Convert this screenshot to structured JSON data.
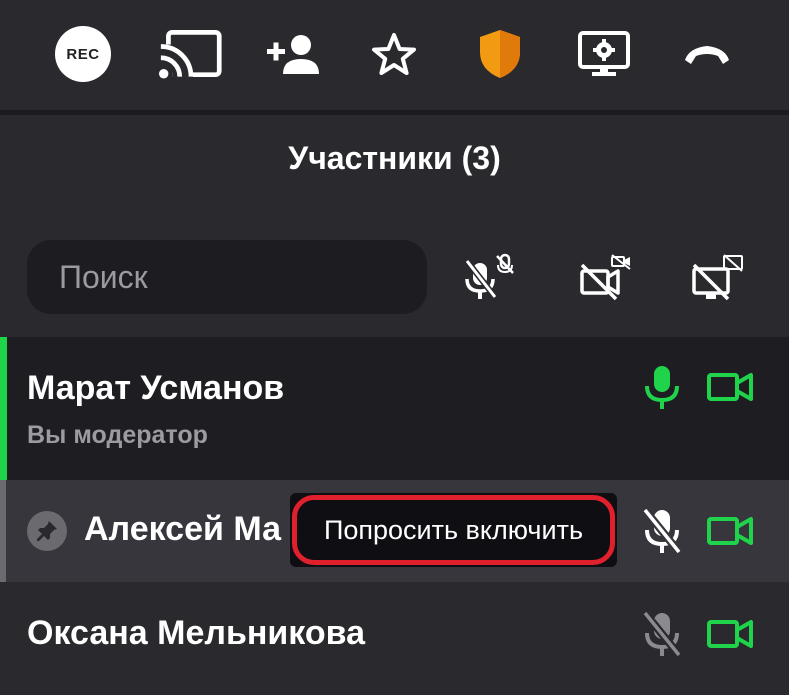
{
  "toolbar": {
    "rec_label": "REC",
    "items": [
      {
        "icon": "rec-icon"
      },
      {
        "icon": "cast-icon"
      },
      {
        "icon": "add-person-icon"
      },
      {
        "icon": "star-icon"
      },
      {
        "icon": "shield-icon"
      },
      {
        "icon": "screen-settings-icon"
      },
      {
        "icon": "hangup-icon"
      }
    ]
  },
  "panel": {
    "title": "Участники (3)"
  },
  "search": {
    "placeholder": "Поиск",
    "value": ""
  },
  "bulk_actions": [
    {
      "icon": "mute-all-mic-icon"
    },
    {
      "icon": "disable-all-camera-icon"
    },
    {
      "icon": "stop-all-screen-icon"
    }
  ],
  "participants": [
    {
      "name": "Марат Усманов",
      "subtitle": "Вы модератор",
      "mic": "on",
      "camera": "on",
      "speaking": true
    },
    {
      "name": "Алексей Ма",
      "mic": "off",
      "camera": "on",
      "pinned": true,
      "tooltip": "Попросить включить"
    },
    {
      "name": "Оксана Мельникова",
      "mic": "off-dim",
      "camera": "on"
    }
  ],
  "colors": {
    "background": "#2a292e",
    "active_row": "#1e1d22",
    "hover_row": "#37363c",
    "accent_green": "#1fd34a",
    "shield_orange": "#f29a12",
    "tooltip_ring": "#e0202c"
  }
}
